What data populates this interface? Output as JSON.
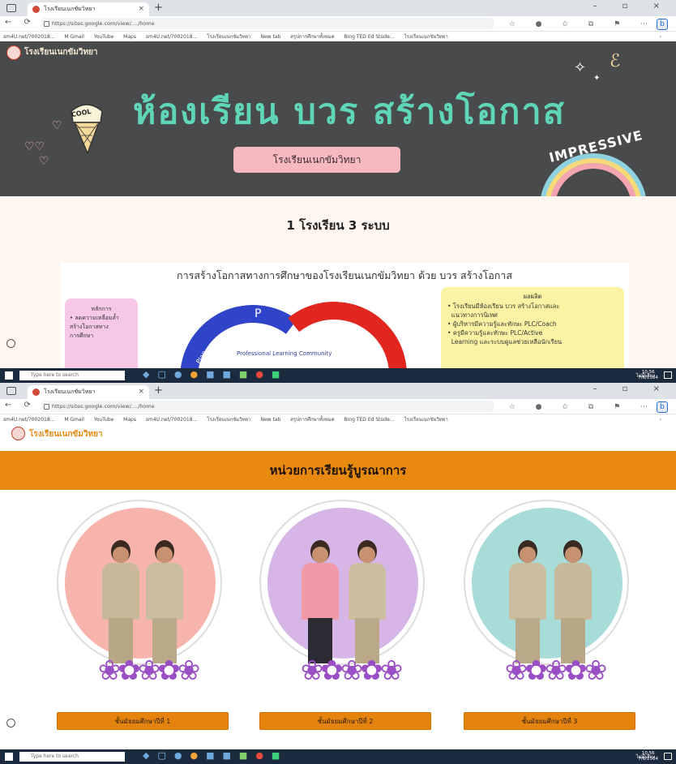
{
  "screen1": {
    "browser": {
      "tab_title": "โรงเรียนเนกขัมวิทยา",
      "url": "https://sites.google.com/view/..../home",
      "bookmarks": [
        "sm4U.net/7002018...",
        "M Gmail",
        "YouTube",
        "Maps",
        "sm4U.net/7002018...",
        "โรงเรียนเนกขัมวิทยา",
        "New tab",
        "สรุปการศึกษาทั้งหมด",
        "Bing TED Ed Stude...",
        "โรงเรียนเนกขัมวิทยา"
      ]
    },
    "hero": {
      "school_name": "โรงเรียนเนกขัมวิทยา",
      "title": "ห้องเรียน บวร สร้างโอกาส",
      "subtitle": "โรงเรียนเนกขัมวิทยา",
      "sticker_text": "COOL",
      "impressive_text": "IMPRESSIVE"
    },
    "section": {
      "heading": "1 โรงเรียน 3 ระบบ",
      "diagram_title": "การสร้างโอกาสทางการศึกษาของโรงเรียนเนกขัมวิทยา ด้วย บวร สร้างโอกาส",
      "left_box": {
        "heading": "หลักการ",
        "items": [
          "ลดความเหลื่อมล้ำ",
          "สร้างโอกาสทาง",
          "การศึกษา"
        ]
      },
      "right_box": {
        "heading": "ผลผลิต",
        "items": [
          "โรงเรียนมีห้องเรียน บวร สร้างโอกาสและ",
          "แนวทางการนิเทศ",
          "ผู้บริหารมีความรู้และทักษะ PLC/Coach",
          "ครูมีความรู้และทักษะ PLC/Active",
          "Learning และระบบดูแลช่วยเหลือนักเรียน"
        ]
      },
      "cycle_label_p": "P",
      "cycle_label_plc": "Professional Learning Community",
      "cycle_label_side": "Plan"
    },
    "taskbar": {
      "search_placeholder": "Type here to search",
      "tray": "ไม่มีเสียง",
      "time": "10:56",
      "date": "7/6/2564"
    }
  },
  "screen2": {
    "browser": {
      "tab_title": "โรงเรียนเนกขัมวิทยา",
      "url": "https://sites.google.com/view/..../home",
      "bookmarks": [
        "sm4U.net/7002018...",
        "M Gmail",
        "YouTube",
        "Maps",
        "sm4U.net/7002018...",
        "โรงเรียนเนกขัมวิทยา",
        "New tab",
        "สรุปการศึกษาทั้งหมด",
        "Bing TED Ed Stude...",
        "โรงเรียนเนกขัมวิทยา"
      ]
    },
    "site_name": "โรงเรียนเนกขัมวิทยา",
    "banner": "หน่วยการเรียนรู้บูรณาการ",
    "cards": [
      {
        "button": "ชั้นมัธยมศึกษาปีที่ 1",
        "ring_color": "#f7b4ac"
      },
      {
        "button": "ชั้นมัธยมศึกษาปีที่ 2",
        "ring_color": "#d6b6e6"
      },
      {
        "button": "ชั้นมัธยมศึกษาปีที่ 3",
        "ring_color": "#a8dcd8"
      }
    ],
    "taskbar": {
      "search_placeholder": "Type here to search",
      "tray": "ไม่มีเสียง",
      "time": "10:56",
      "date": "7/6/2564"
    }
  },
  "colors": {
    "hero_bg": "#494a4c",
    "hero_title": "#5fd6b8",
    "banner": "#e88a10",
    "button": "#e4840f",
    "content_bg": "#fff7ef"
  }
}
